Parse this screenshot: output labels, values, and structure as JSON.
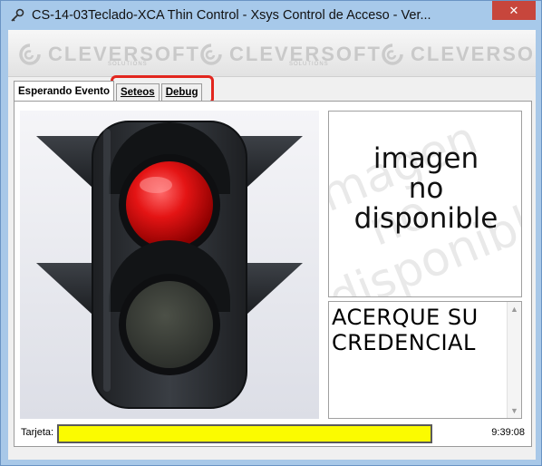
{
  "window": {
    "title": "CS-14-03Teclado-XCA Thin Control - Xsys Control de Acceso - Ver...",
    "close_glyph": "✕"
  },
  "banner": {
    "logo_text": "CLEVERSOFT",
    "logo_subtext": "SOLUTIONS"
  },
  "tabs": [
    {
      "label": "Esperando Evento",
      "active": true
    },
    {
      "label": "Seteos",
      "active": false
    },
    {
      "label": "Debug",
      "active": false
    }
  ],
  "traffic_light": {
    "state": "red",
    "colors": {
      "red": "#e01515",
      "off": "#3f423d",
      "housing": "#2a2d31"
    }
  },
  "image_panel": {
    "lines": [
      "imagen",
      "no",
      "disponible"
    ]
  },
  "message": {
    "lines": [
      "ACERQUE SU",
      "CREDENCIAL"
    ]
  },
  "status": {
    "card_label": "Tarjeta:",
    "card_value": "",
    "time": "9:39:08",
    "card_field_color": "#fbfb00"
  },
  "colors": {
    "titlebar": "#a7c9ea",
    "close_button": "#c7463c",
    "highlight": "#e2261e"
  }
}
